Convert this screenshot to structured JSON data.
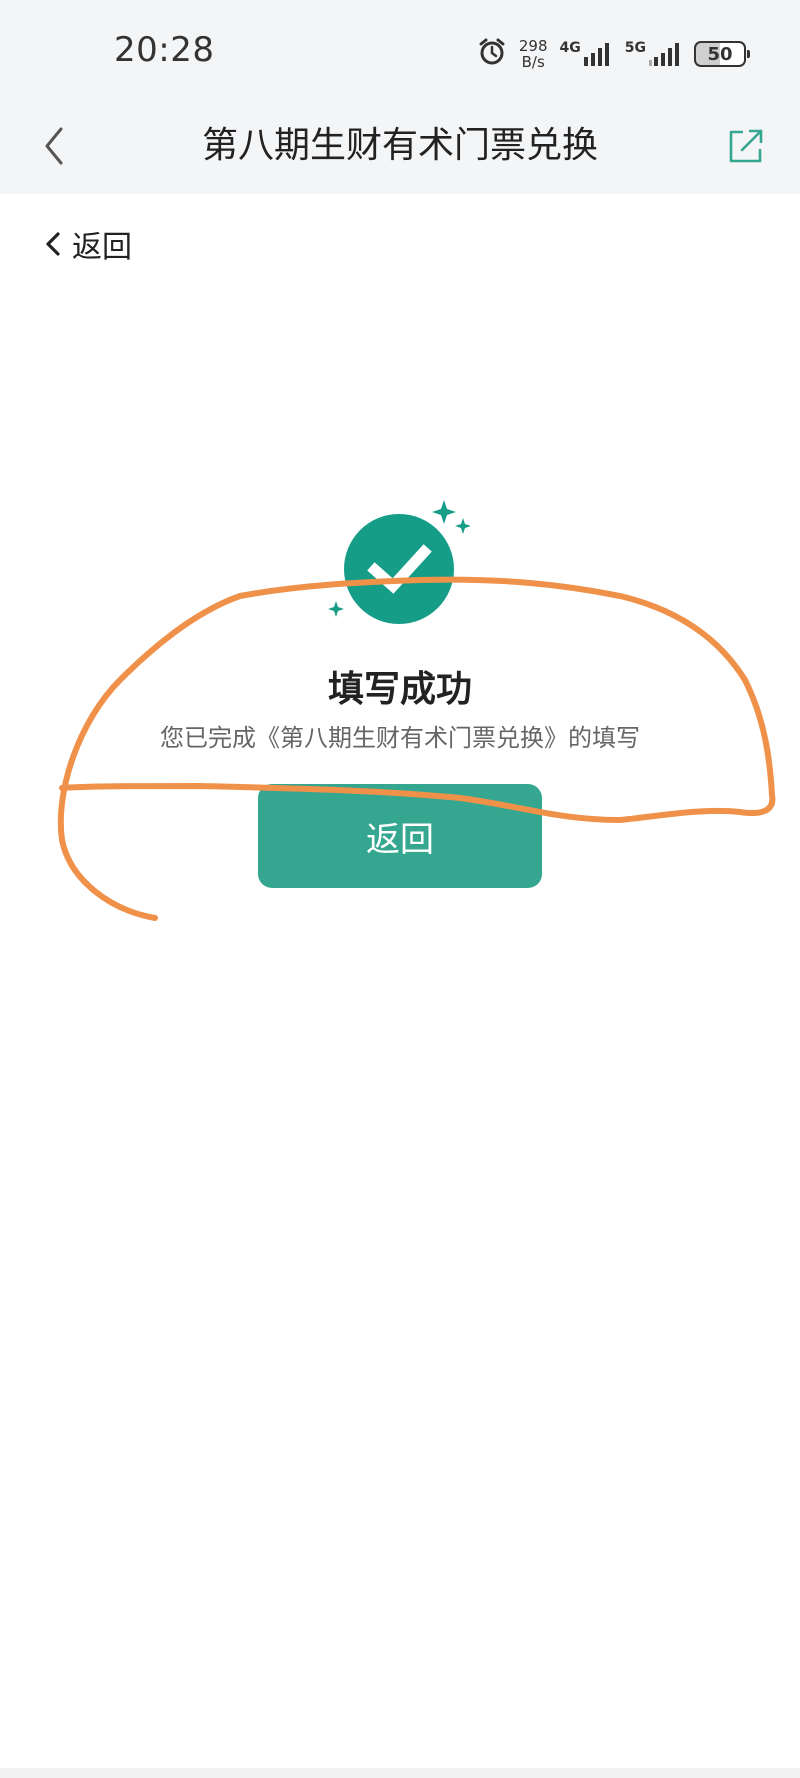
{
  "status_bar": {
    "time": "20:28",
    "speed_value": "298",
    "speed_unit": "B/s",
    "network_1": "4G",
    "network_2": "5G",
    "battery": "50"
  },
  "nav": {
    "title": "第八期生财有术门票兑换",
    "back_icon": "chevron-left-icon",
    "share_icon": "external-link-icon"
  },
  "page": {
    "back_label": "返回",
    "success_title": "填写成功",
    "success_desc": "您已完成《第八期生财有术门票兑换》的填写",
    "return_button_label": "返回"
  },
  "colors": {
    "accent": "#35a690",
    "annotation": "#f0914a",
    "header_bg": "#f4f5f7"
  }
}
